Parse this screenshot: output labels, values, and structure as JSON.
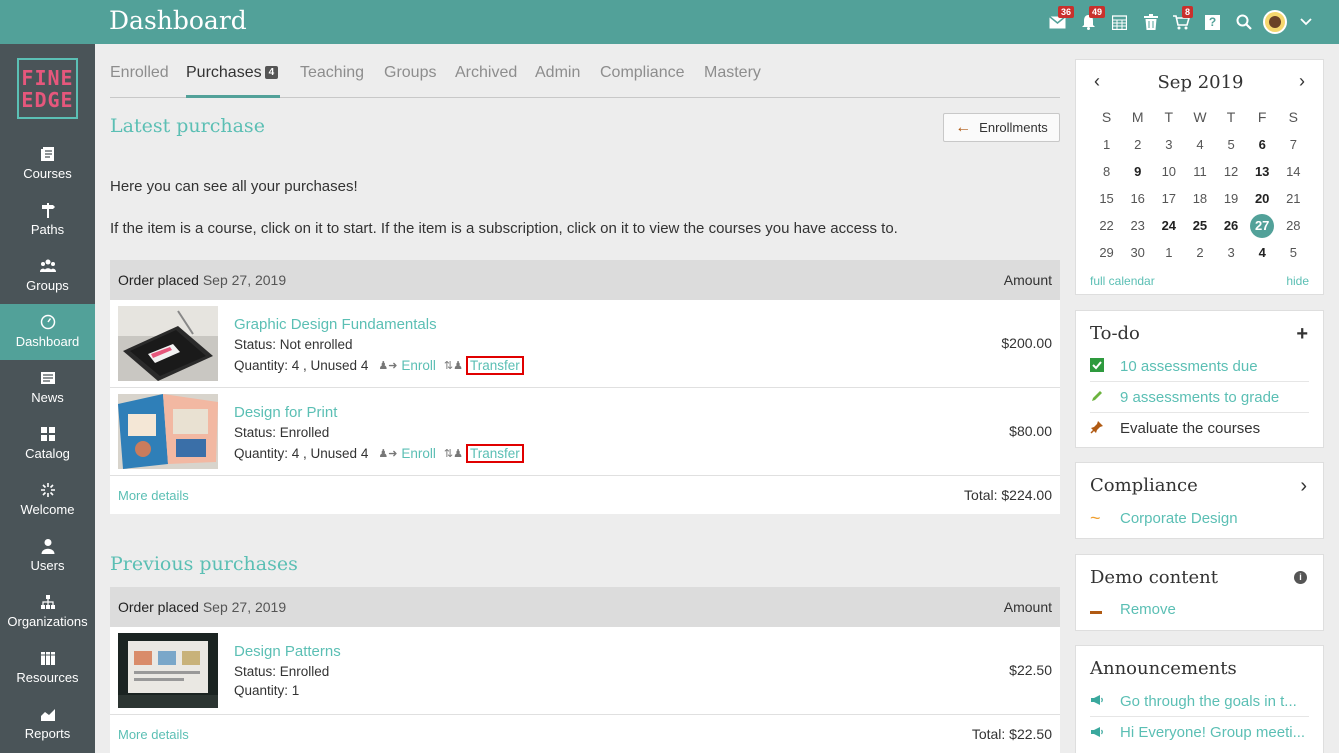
{
  "header": {
    "title": "Dashboard",
    "icons": [
      {
        "name": "messages-icon",
        "badge": "36"
      },
      {
        "name": "notifications-icon",
        "badge": "49"
      },
      {
        "name": "calendar-icon",
        "badge": ""
      },
      {
        "name": "trash-icon",
        "badge": ""
      },
      {
        "name": "cart-icon",
        "badge": "8"
      },
      {
        "name": "help-icon",
        "badge": ""
      },
      {
        "name": "search-icon",
        "badge": ""
      }
    ]
  },
  "logo": {
    "line1": "FINE",
    "line2": "EDGE"
  },
  "sidebar": {
    "items": [
      {
        "label": "Courses"
      },
      {
        "label": "Paths"
      },
      {
        "label": "Groups"
      },
      {
        "label": "Dashboard"
      },
      {
        "label": "News"
      },
      {
        "label": "Catalog"
      },
      {
        "label": "Welcome"
      },
      {
        "label": "Users"
      },
      {
        "label": "Organizations"
      },
      {
        "label": "Resources"
      },
      {
        "label": "Reports"
      }
    ]
  },
  "tabs": {
    "enrolled": "Enrolled",
    "purchases": "Purchases",
    "purchases_count": "4",
    "teaching": "Teaching",
    "groups": "Groups",
    "archived": "Archived",
    "admin": "Admin",
    "compliance": "Compliance",
    "mastery": "Mastery"
  },
  "latest": {
    "title": "Latest purchase",
    "enrollments_button": "Enrollments",
    "intro1": "Here you can see all your purchases!",
    "intro2": "If the item is a course, click on it to start. If the item is a subscription, click on it to view the courses you have access to.",
    "order_label": "Order placed",
    "order_date": "Sep 27, 2019",
    "amount_label": "Amount",
    "items": [
      {
        "title": "Graphic Design Fundamentals",
        "status": "Status: Not enrolled",
        "qty": "Quantity: 4 , Unused 4",
        "enroll": "Enroll",
        "transfer": "Transfer",
        "price": "$200.00"
      },
      {
        "title": "Design for Print",
        "status": "Status: Enrolled",
        "qty": "Quantity: 4 , Unused 4",
        "enroll": "Enroll",
        "transfer": "Transfer",
        "price": "$80.00"
      }
    ],
    "more_details": "More details",
    "total": "Total: $224.00"
  },
  "previous": {
    "title": "Previous purchases",
    "order_label": "Order placed",
    "order_date": "Sep 27, 2019",
    "amount_label": "Amount",
    "item": {
      "title": "Design Patterns",
      "status": "Status: Enrolled",
      "qty": "Quantity: 1",
      "price": "$22.50"
    },
    "more_details": "More details",
    "total": "Total: $22.50"
  },
  "calendar": {
    "month": "Sep 2019",
    "weekdays": [
      "S",
      "M",
      "T",
      "W",
      "T",
      "F",
      "S"
    ],
    "weeks": [
      [
        "1",
        "2",
        "3",
        "4",
        "5",
        "6",
        "7"
      ],
      [
        "8",
        "9",
        "10",
        "11",
        "12",
        "13",
        "14"
      ],
      [
        "15",
        "16",
        "17",
        "18",
        "19",
        "20",
        "21"
      ],
      [
        "22",
        "23",
        "24",
        "25",
        "26",
        "27",
        "28"
      ],
      [
        "29",
        "30",
        "1",
        "2",
        "3",
        "4",
        "5"
      ]
    ],
    "bold_days": [
      "6",
      "9",
      "13",
      "20",
      "24",
      "25",
      "26",
      "4"
    ],
    "today": "27",
    "full_calendar": "full calendar",
    "hide": "hide"
  },
  "todo": {
    "title": "To-do",
    "items": [
      {
        "label": "10 assessments due",
        "color": "#2e9a3e"
      },
      {
        "label": "9 assessments to grade",
        "color": "#6cb33f"
      },
      {
        "label": "Evaluate the courses",
        "color": "#b05a13"
      }
    ]
  },
  "compliance": {
    "title": "Compliance",
    "item": "Corporate Design"
  },
  "demo": {
    "title": "Demo content",
    "item": "Remove"
  },
  "announcements": {
    "title": "Announcements",
    "items": [
      "Go through the goals in t...",
      "Hi Everyone! Group meeti..."
    ]
  },
  "colors": {
    "accent": "#52a199",
    "link": "#5bbfb4",
    "sidebar": "#4a5458",
    "highlight": "#e00000"
  }
}
